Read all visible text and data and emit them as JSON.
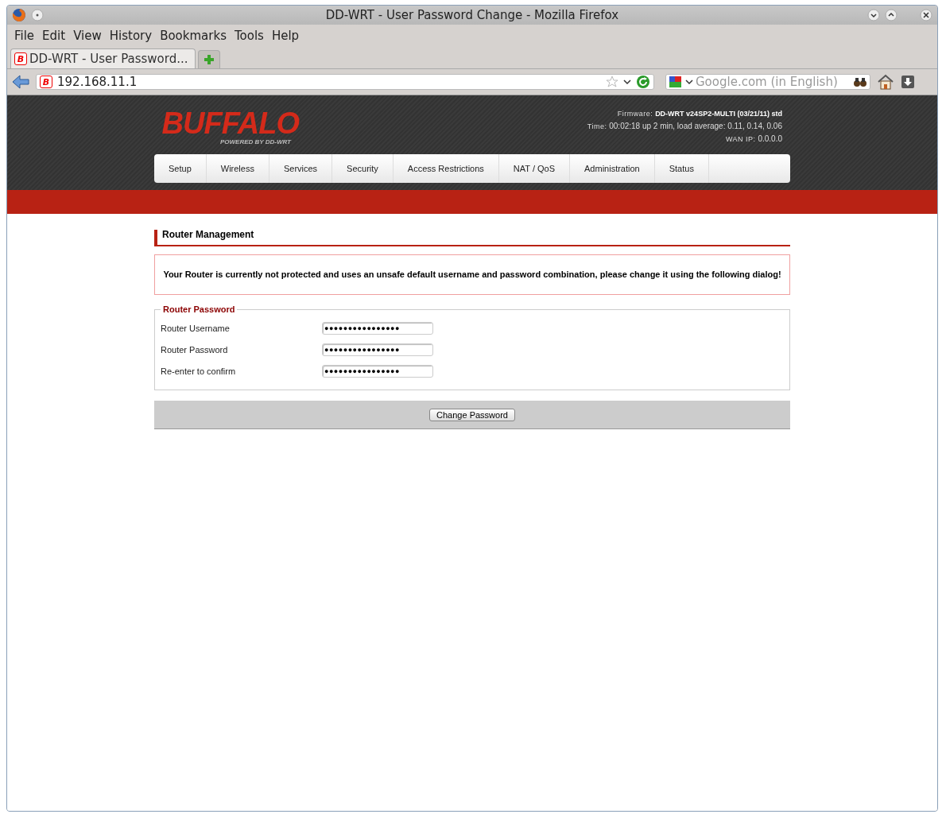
{
  "window": {
    "title": "DD-WRT - User Password Change - Mozilla Firefox"
  },
  "menu": [
    "File",
    "Edit",
    "View",
    "History",
    "Bookmarks",
    "Tools",
    "Help"
  ],
  "tabs": [
    {
      "label": "DD-WRT - User Password...",
      "icon_text": "B",
      "selected": true
    }
  ],
  "address": {
    "value": "192.168.11.1",
    "icon_text": "B"
  },
  "search": {
    "placeholder": "Google.com (in English)"
  },
  "header": {
    "logo": "BUFFALO",
    "logo_sub": "POWERED BY DD-WRT",
    "info": [
      {
        "label": "Firmware:",
        "value": "DD-WRT v24SP2-MULTI (03/21/11) std"
      },
      {
        "label": "Time:",
        "value": "00:02:18 up 2 min, load average: 0.11, 0.14, 0.06"
      },
      {
        "label": "WAN IP:",
        "value": "0.0.0.0"
      }
    ]
  },
  "nav": [
    "Setup",
    "Wireless",
    "Services",
    "Security",
    "Access Restrictions",
    "NAT / QoS",
    "Administration",
    "Status"
  ],
  "section": {
    "title": "Router Management",
    "warning": "Your Router is currently not protected and uses an unsafe default username and password combination, please change it using the following dialog!",
    "fieldset": {
      "legend": "Router Password",
      "fields": [
        {
          "label": "Router Username",
          "value": "●●●●●●●●●●●●●●●●"
        },
        {
          "label": "Router Password",
          "value": "●●●●●●●●●●●●●●●●"
        },
        {
          "label": "Re-enter to confirm",
          "value": "●●●●●●●●●●●●●●●●"
        }
      ]
    },
    "button": "Change Password"
  }
}
